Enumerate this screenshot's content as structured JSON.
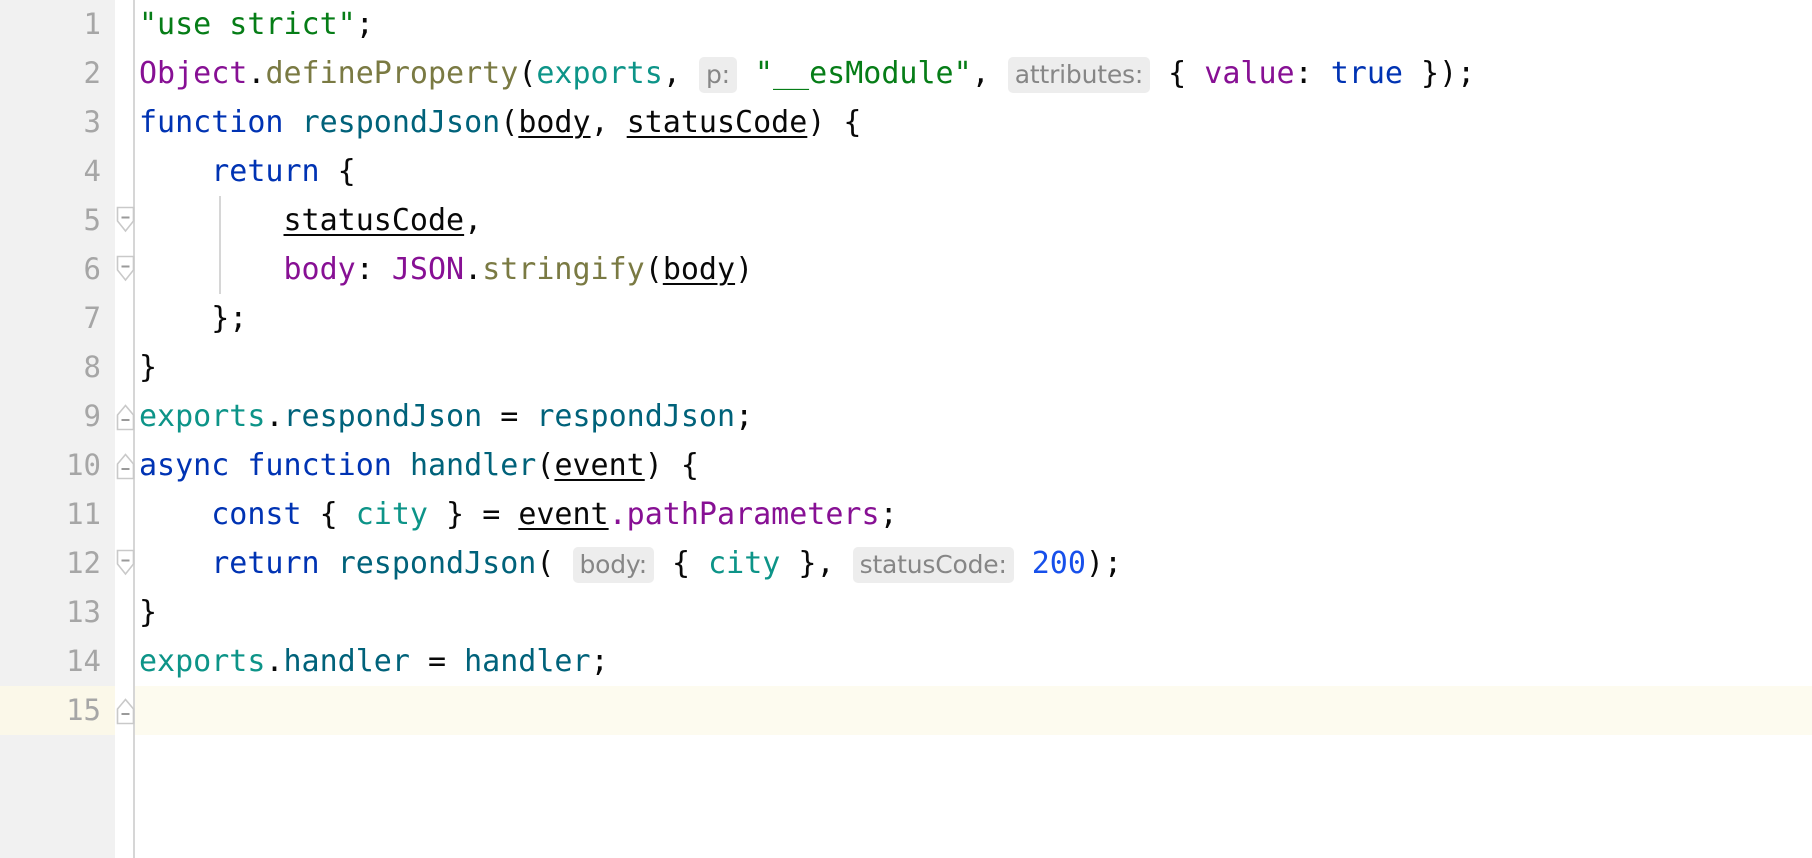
{
  "editor": {
    "language": "javascript",
    "theme": "IntelliJ Light",
    "total_lines": 15,
    "caret_line": 15,
    "colors": {
      "background": "#ffffff",
      "gutter_background": "#f1f1f1",
      "line_number": "#a6a6a6",
      "caret_line_highlight": "#fdfbef",
      "caret_line_gutter_highlight": "#fbf8e9",
      "fold_separator": "#d6d6d6",
      "indent_guide": "#d6d6d6",
      "string": "#067d17",
      "keyword": "#0033b3",
      "number": "#1750eb",
      "property": "#871094",
      "function_call": "#7a7a43",
      "function_declaration": "#00627a",
      "exports_identifier": "#0d9488",
      "local_variable": "#0d9488",
      "plain_text": "#080808",
      "inlay_hint_text": "#868686",
      "inlay_hint_background": "#ededed"
    }
  },
  "gutter": {
    "line_numbers": [
      "1",
      "2",
      "3",
      "4",
      "5",
      "6",
      "7",
      "8",
      "9",
      "10",
      "11",
      "12",
      "13",
      "14",
      "15"
    ],
    "fold_markers": [
      {
        "line": 3,
        "type": "fold-start",
        "icon": "minus-box-down-icon"
      },
      {
        "line": 4,
        "type": "fold-start",
        "icon": "minus-box-down-icon"
      },
      {
        "line": 7,
        "type": "fold-end",
        "icon": "minus-box-up-icon"
      },
      {
        "line": 8,
        "type": "fold-end",
        "icon": "minus-box-up-icon"
      },
      {
        "line": 10,
        "type": "fold-start",
        "icon": "minus-box-down-icon"
      },
      {
        "line": 13,
        "type": "fold-end",
        "icon": "minus-box-up-icon"
      }
    ]
  },
  "code": {
    "lines": [
      {
        "n": 1,
        "text": "\"use strict\";"
      },
      {
        "n": 2,
        "text": "Object.defineProperty(exports, p: \"__esModule\", attributes: { value: true });"
      },
      {
        "n": 3,
        "text": "function respondJson(body, statusCode) {"
      },
      {
        "n": 4,
        "text": "    return {"
      },
      {
        "n": 5,
        "text": "        statusCode,"
      },
      {
        "n": 6,
        "text": "        body: JSON.stringify(body)"
      },
      {
        "n": 7,
        "text": "    };"
      },
      {
        "n": 8,
        "text": "}"
      },
      {
        "n": 9,
        "text": "exports.respondJson = respondJson;"
      },
      {
        "n": 10,
        "text": "async function handler(event) {"
      },
      {
        "n": 11,
        "text": "    const { city } = event.pathParameters;"
      },
      {
        "n": 12,
        "text": "    return respondJson( body: { city }, statusCode: 200);"
      },
      {
        "n": 13,
        "text": "}"
      },
      {
        "n": 14,
        "text": "exports.handler = handler;"
      },
      {
        "n": 15,
        "text": ""
      }
    ]
  },
  "tokens": {
    "l1_string": "\"use strict\"",
    "l1_semi": ";",
    "l2_object": "Object",
    "l2_dot": ".",
    "l2_defineproperty": "defineProperty",
    "l2_paren_open": "(",
    "l2_exports": "exports",
    "l2_comma1": ", ",
    "l2_hint_p": "p:",
    "l2_esmodule": "\"__esModule\"",
    "l2_comma2": ", ",
    "l2_hint_attributes": "attributes:",
    "l2_brace_open": " { ",
    "l2_value": "value",
    "l2_colon": ": ",
    "l2_true": "true",
    "l2_tail": " });",
    "l3_function": "function",
    "l3_space": " ",
    "l3_respondjson": "respondJson",
    "l3_paren_open": "(",
    "l3_body": "body",
    "l3_comma": ", ",
    "l3_statuscode": "statusCode",
    "l3_tail": ") {",
    "l4_indent": "    ",
    "l4_return": "return",
    "l4_brace": " {",
    "l5_indent": "        ",
    "l5_statuscode": "statusCode",
    "l5_comma": ",",
    "l6_indent": "        ",
    "l6_body_key": "body",
    "l6_colon": ": ",
    "l6_json": "JSON",
    "l6_dot": ".",
    "l6_stringify": "stringify",
    "l6_paren_open": "(",
    "l6_body_arg": "body",
    "l6_paren_close": ")",
    "l7_indent": "    ",
    "l7_close": "};",
    "l8_close": "}",
    "l9_exports": "exports",
    "l9_dot": ".",
    "l9_respondjson": "respondJson",
    "l9_equals": " = ",
    "l9_value": "respondJson",
    "l9_semi": ";",
    "l10_async": "async",
    "l10_space1": " ",
    "l10_function": "function",
    "l10_space2": " ",
    "l10_handler": "handler",
    "l10_paren_open": "(",
    "l10_event": "event",
    "l10_tail": ") {",
    "l11_indent": "    ",
    "l11_const": "const",
    "l11_brace_open": " { ",
    "l11_city": "city",
    "l11_brace_close": " } ",
    "l11_equals": "= ",
    "l11_event": "event",
    "l11_pathparams": ".pathParameters",
    "l11_semi": ";",
    "l12_indent": "    ",
    "l12_return": "return",
    "l12_space": " ",
    "l12_respondjson": "respondJson",
    "l12_paren_open": "( ",
    "l12_hint_body": "body:",
    "l12_brace_open": " { ",
    "l12_city": "city",
    "l12_brace_close": " }, ",
    "l12_hint_statuscode": "statusCode:",
    "l12_space2": " ",
    "l12_200": "200",
    "l12_tail": ");",
    "l13_close": "}",
    "l14_exports": "exports",
    "l14_dot": ".",
    "l14_handler": "handler",
    "l14_equals": " = ",
    "l14_value": "handler",
    "l14_semi": ";"
  }
}
